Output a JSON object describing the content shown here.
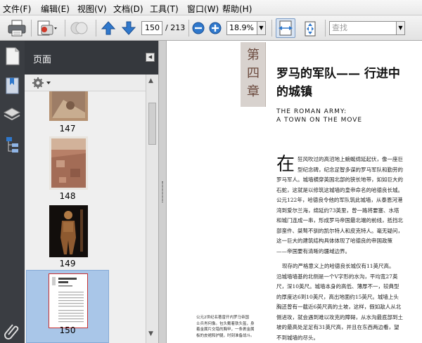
{
  "menu": [
    "文件(F)",
    "编辑(E)",
    "视图(V)",
    "文档(D)",
    "工具(T)",
    "窗口(W)",
    "帮助(H)"
  ],
  "toolbar": {
    "page_current": "150",
    "page_total": "/ 213",
    "zoom": "18.9%",
    "search_placeholder": "查找"
  },
  "panel": {
    "title": "页面"
  },
  "thumbnails": [
    {
      "label": "147"
    },
    {
      "label": "148"
    },
    {
      "label": "149"
    },
    {
      "label": "150"
    }
  ],
  "document": {
    "chapter_mark": [
      "第",
      "四",
      "章"
    ],
    "title_line1": "罗马的军队—— 行进中",
    "title_line2": "的城镇",
    "subtitle_line1": "THE ROMAN ARMY:",
    "subtitle_line2": "A TOWN ON THE MOVE",
    "drop_cap": "在",
    "para1_lines": [
      "狂风吹过的高沼地上蜿蜒绵延起伏，像一座巨",
      "型纪念碑，纪念足智多谋的罗马军队和勤劳的",
      "罗马军人。城墙横穿英国北部的狭长地带，如如巨大的",
      "石蛇，这就是以修筑这城墙的皇帝命名的哈德良长城。",
      "公元122年，哈德良令他的军队筑此城墙，从泰恩河港",
      "湾到爱尔兰海，绵延约73英里，曾一路将要塞、水塔",
      "和城门连成一串，形成罗马帝国最北端的前线，抵挡北",
      "部蛮件、桀骜不驯的凯尔特人和皮克特人。毫无疑问，",
      "这一巨大的建筑结构具体体现了哈德良的帝国政策",
      "——帝国要有清晰的疆域边界。"
    ],
    "para2_lines": [
      "现存的严格意义上的哈德良长城仅有11英尺高。",
      "沿城墙墙基的北侧是一个V字形的水沟，平均宽27英",
      "尺，深10英尺。城墙本身的高低、薄厚不一，较典型",
      "的厚度达6到10英尺，高出地面约15英尺。城墙上头",
      "胸还曾有一截近6英尺高的土坡，这样，假如敌人从北",
      "侧进攻，就会遇到难以攻克的障碍，从水沟最底部到土",
      "坡的最高处足足有31英尺高，并且在东西两边看，望",
      "不到城墙的尽头。"
    ],
    "caption_lines": [
      "公元2世纪名著曾开内罗马帝国",
      "士兵肖何像。包头戴着铁头盔，身",
      "着金属片交错的胸甲，一条裹金属",
      "板的皮裙和护腿，时刻准备战斗。"
    ]
  },
  "colors": {
    "accent": "#2b6cc4",
    "sidebar": "#3a3d42",
    "selection": "#a9c6e8"
  }
}
